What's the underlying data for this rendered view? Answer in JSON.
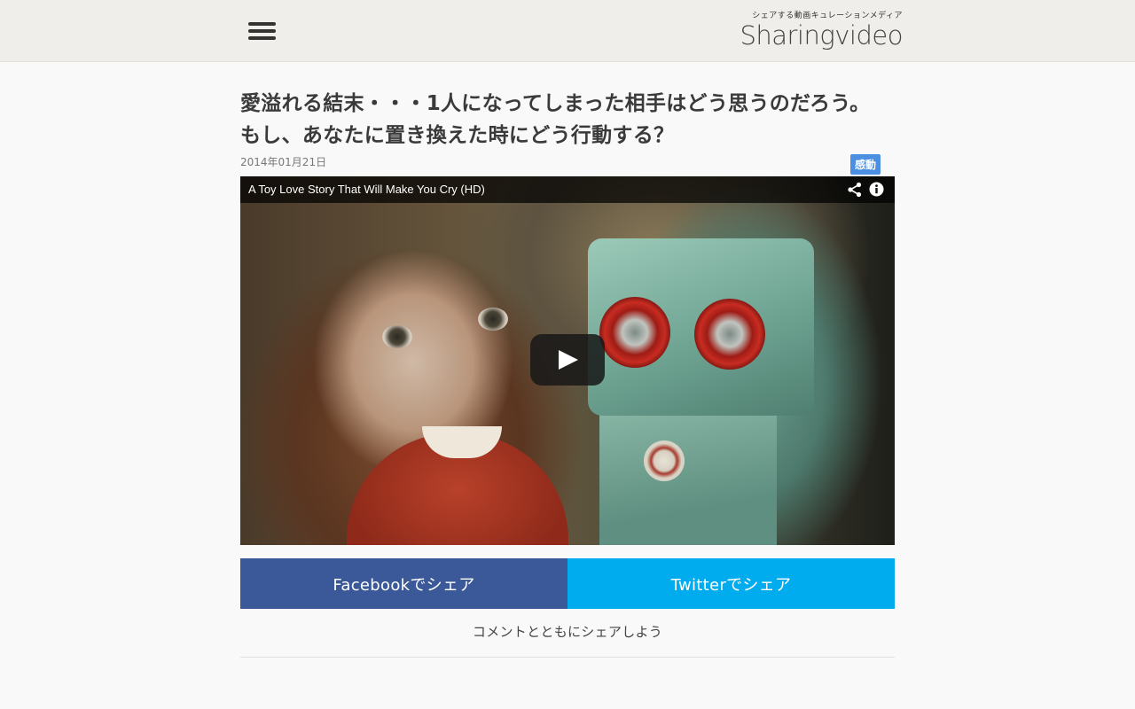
{
  "header": {
    "menu_icon": "hamburger-menu-icon",
    "logo_tagline": "シェアする動画キュレーションメディア",
    "logo_name": "Sharingvideo"
  },
  "article": {
    "title_line1": "愛溢れる結末・・・1人になってしまった相手はどう思うのだろう。",
    "title_line2": "もし、あなたに置き換えた時にどう行動する？",
    "date": "2014年01月21日",
    "category": "感動"
  },
  "video": {
    "title": "A Toy Love Story That Will Make You Cry (HD)",
    "icons": [
      "share-icon",
      "info-icon",
      "play-icon"
    ]
  },
  "share": {
    "facebook_label": "Facebookでシェア",
    "twitter_label": "Twitterでシェア",
    "comment_hint": "コメントとともにシェアしよう"
  },
  "colors": {
    "facebook": "#3b5998",
    "twitter": "#00acee",
    "category_badge": "#4a8fe1",
    "header_bg": "#efeeea"
  }
}
